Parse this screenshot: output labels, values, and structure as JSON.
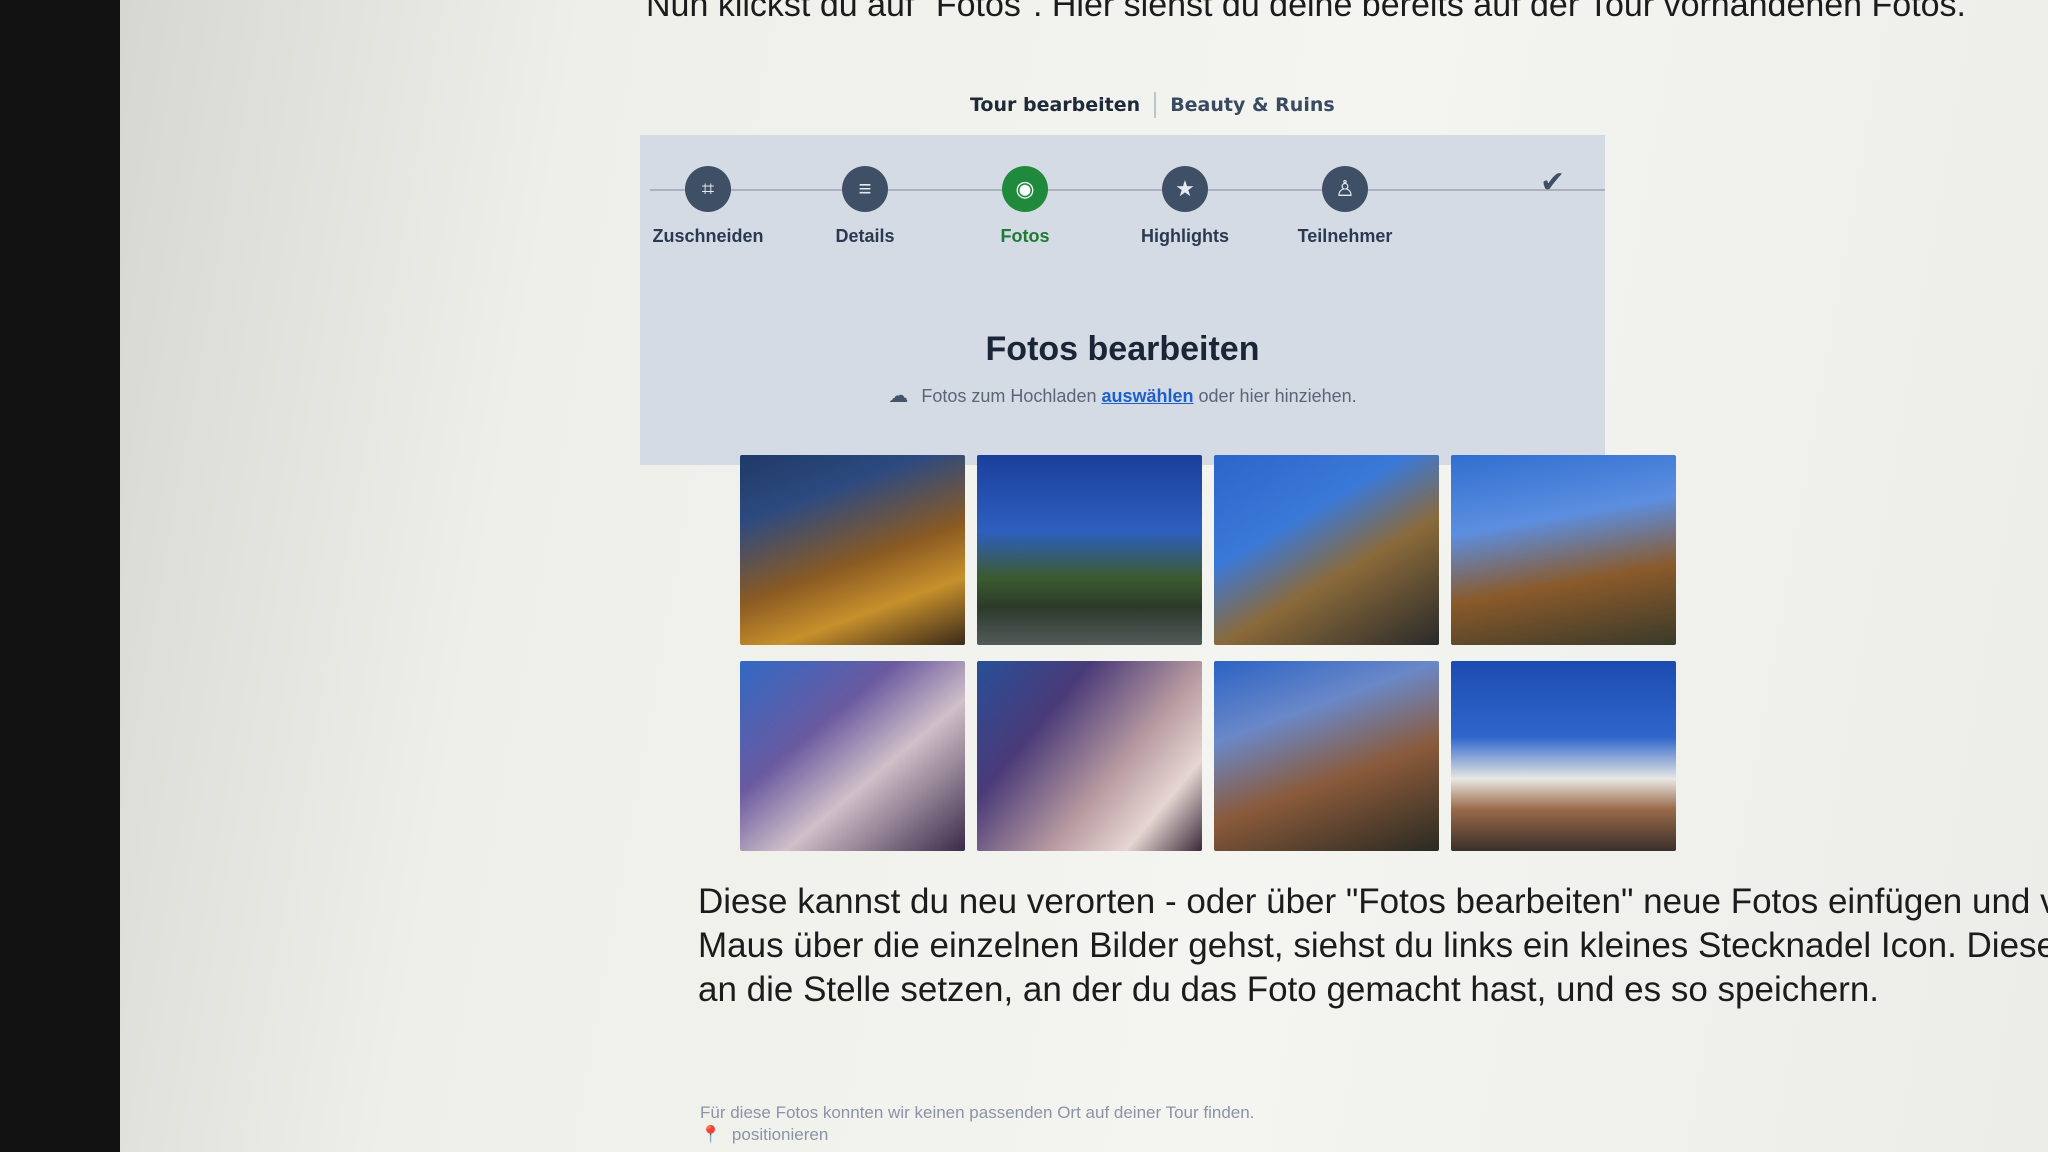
{
  "intro_text": "Nun klickst du auf \"Fotos\". Hier siehst du deine bereits auf der Tour vorhandenen Fotos.",
  "breadcrumb": {
    "item1": "Tour bearbeiten",
    "item2": "Beauty & Ruins"
  },
  "steps": [
    {
      "label": "Zuschneiden",
      "icon": "crop-icon",
      "active": false
    },
    {
      "label": "Details",
      "icon": "list-icon",
      "active": false
    },
    {
      "label": "Fotos",
      "icon": "camera-icon",
      "active": true
    },
    {
      "label": "Highlights",
      "icon": "star-icon",
      "active": false
    },
    {
      "label": "Teilnehmer",
      "icon": "person-icon",
      "active": false
    }
  ],
  "finish_icon": "checkmark-icon",
  "editor": {
    "title": "Fotos bearbeiten",
    "upload_prefix": "Fotos zum Hochladen",
    "upload_link": "auswählen",
    "upload_suffix": "oder hier hinziehen."
  },
  "photos": [
    "photo-1",
    "photo-2",
    "photo-3",
    "photo-4",
    "photo-5",
    "photo-6",
    "photo-7",
    "photo-8"
  ],
  "body_text": {
    "line1": "Diese kannst du neu verorten - oder über \"Fotos bearbeiten\" neue Fotos einfügen und v",
    "line2": "Maus über die einzelnen Bilder gehst, siehst du links ein kleines Stecknadel Icon. Diese",
    "line3": "an die Stelle setzen, an der du das Foto gemacht hast, und es so speichern."
  },
  "note": {
    "line1": "Für diese Fotos konnten wir keinen passenden Ort auf deiner Tour finden.",
    "line2": "positionieren"
  },
  "colors": {
    "active_step": "#1f8a3c",
    "step_dot": "#3f5066",
    "link": "#1f5fc8",
    "editor_bg": "#d5dbe4"
  }
}
